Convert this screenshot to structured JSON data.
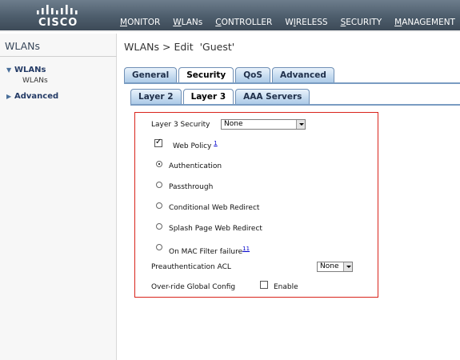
{
  "header": {
    "brand": "CISCO",
    "menu": [
      "MONITOR",
      "WLANs",
      "CONTROLLER",
      "WIRELESS",
      "SECURITY",
      "MANAGEMENT"
    ]
  },
  "sidebar": {
    "title": "WLANs",
    "groups": [
      {
        "label": "WLANs",
        "expanded": true,
        "children": [
          "WLANs"
        ]
      },
      {
        "label": "Advanced",
        "expanded": false
      }
    ]
  },
  "page": {
    "title": "WLANs > Edit  'Guest'"
  },
  "tabs": {
    "primary": [
      "General",
      "Security",
      "QoS",
      "Advanced"
    ],
    "primary_active": "Security",
    "secondary": [
      "Layer 2",
      "Layer 3",
      "AAA Servers"
    ],
    "secondary_active": "Layer 3"
  },
  "form": {
    "layer3_security_label": "Layer 3 Security",
    "layer3_security_value": "None",
    "web_policy_label": "Web Policy",
    "web_policy_note": "1",
    "web_policy_checked": true,
    "options": [
      {
        "label": "Authentication",
        "checked": true
      },
      {
        "label": "Passthrough",
        "checked": false
      },
      {
        "label": "Conditional Web Redirect",
        "checked": false
      },
      {
        "label": "Splash Page Web Redirect",
        "checked": false
      },
      {
        "label": "On MAC Filter failure",
        "checked": false,
        "note": "11"
      }
    ],
    "preauth_acl_label": "Preauthentication ACL",
    "preauth_acl_value": "None",
    "override_label": "Over-ride Global Config",
    "override_enable_label": "Enable",
    "override_checked": false
  },
  "colors": {
    "highlight_border": "#d9231b",
    "tab_border": "#6f8fb5",
    "topbar": "#4d5d6c"
  }
}
